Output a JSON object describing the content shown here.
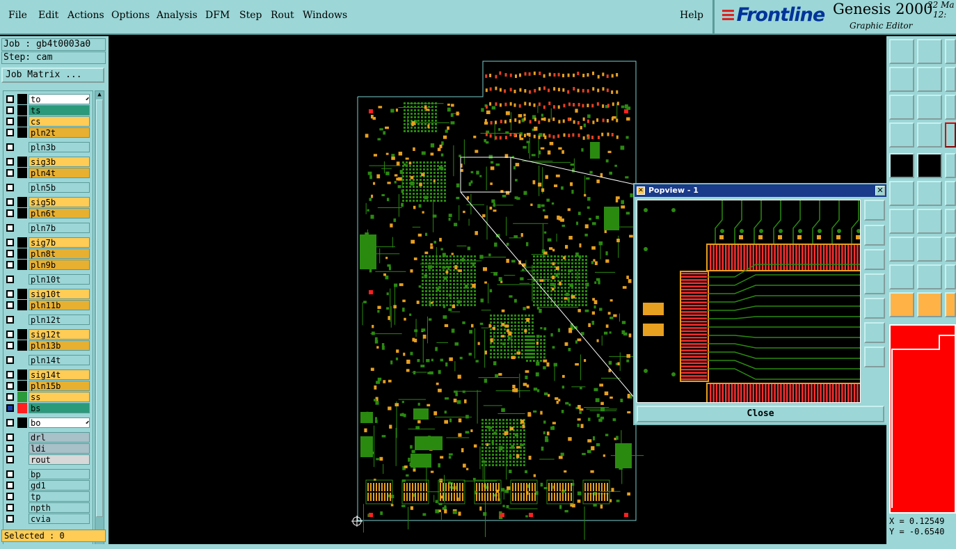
{
  "menu": {
    "file": "File",
    "edit": "Edit",
    "actions": "Actions",
    "options": "Options",
    "analysis": "Analysis",
    "dfm": "DFM",
    "step": "Step",
    "rout": "Rout",
    "windows": "Windows",
    "help": "Help"
  },
  "brand": {
    "logo": "Frontline",
    "title": "Genesis 2000",
    "subtitle": "Graphic Editor",
    "date_top": "22 Ma",
    "date_bottom": "12:"
  },
  "job": {
    "job_line": "Job : gb4t0003a0",
    "step_line": "Step: cam",
    "matrix_button": "Job Matrix ..."
  },
  "layers": [
    {
      "name": "to",
      "color": "#ffffff",
      "swatch": "#000000",
      "marker": "⬋"
    },
    {
      "name": "ts",
      "color": "#2a9a7a",
      "swatch": "#000000"
    },
    {
      "name": "cs",
      "color": "#ffcc55",
      "swatch": "#000000"
    },
    {
      "name": "pln2t",
      "color": "#e8b030",
      "swatch": "#000000"
    },
    {
      "name": "pln3b",
      "color": "#9cd6d6",
      "swatch": "#9cd6d6"
    },
    {
      "name": "sig3b",
      "color": "#ffcc55",
      "swatch": "#000000"
    },
    {
      "name": "pln4t",
      "color": "#e8b030",
      "swatch": "#000000"
    },
    {
      "name": "pln5b",
      "color": "#9cd6d6",
      "swatch": "#9cd6d6"
    },
    {
      "name": "sig5b",
      "color": "#ffcc55",
      "swatch": "#000000"
    },
    {
      "name": "pln6t",
      "color": "#e8b030",
      "swatch": "#000000"
    },
    {
      "name": "pln7b",
      "color": "#9cd6d6",
      "swatch": "#9cd6d6"
    },
    {
      "name": "sig7b",
      "color": "#ffcc55",
      "swatch": "#000000"
    },
    {
      "name": "pln8t",
      "color": "#e8b030",
      "swatch": "#000000"
    },
    {
      "name": "pln9b",
      "color": "#e8b030",
      "swatch": "#000000"
    },
    {
      "name": "pln10t",
      "color": "#9cd6d6",
      "swatch": "#9cd6d6"
    },
    {
      "name": "sig10t",
      "color": "#ffcc55",
      "swatch": "#000000"
    },
    {
      "name": "pln11b",
      "color": "#e8b030",
      "swatch": "#000000"
    },
    {
      "name": "pln12t",
      "color": "#9cd6d6",
      "swatch": "#9cd6d6"
    },
    {
      "name": "sig12t",
      "color": "#ffcc55",
      "swatch": "#000000"
    },
    {
      "name": "pln13b",
      "color": "#e8b030",
      "swatch": "#000000"
    },
    {
      "name": "pln14t",
      "color": "#9cd6d6",
      "swatch": "#9cd6d6"
    },
    {
      "name": "sig14t",
      "color": "#ffcc55",
      "swatch": "#000000"
    },
    {
      "name": "pln15b",
      "color": "#e8b030",
      "swatch": "#000000"
    },
    {
      "name": "ss",
      "color": "#ffcc55",
      "swatch": "#2a9a3a"
    },
    {
      "name": "bs",
      "color": "#2a9a7a",
      "swatch": "#ff2020",
      "checked": true
    },
    {
      "name": "bo",
      "color": "#ffffff",
      "swatch": "#000000",
      "marker": "⬋"
    },
    {
      "name": "drl",
      "color": "#a8c0c8",
      "swatch": "#9cd6d6"
    },
    {
      "name": "ldi",
      "color": "#a8c0c8",
      "swatch": "#9cd6d6"
    },
    {
      "name": "rout",
      "color": "#d8d8d8",
      "swatch": "#9cd6d6"
    },
    {
      "name": "bp",
      "color": "#9cd6d6",
      "swatch": "#9cd6d6"
    },
    {
      "name": "gd1",
      "color": "#9cd6d6",
      "swatch": "#9cd6d6"
    },
    {
      "name": "tp",
      "color": "#9cd6d6",
      "swatch": "#9cd6d6"
    },
    {
      "name": "npth",
      "color": "#9cd6d6",
      "swatch": "#9cd6d6"
    },
    {
      "name": "cvia",
      "color": "#9cd6d6",
      "swatch": "#9cd6d6"
    }
  ],
  "status": {
    "selected": "Selected : 0"
  },
  "coords": {
    "x": "X = 0.12549",
    "y": "Y = -0.6540"
  },
  "popview": {
    "title": "Popview - 1",
    "close_label": "Close"
  },
  "colors": {
    "panel": "#9cd6d6",
    "board_outline": "#7ad0d0",
    "copper": "#2a8a10",
    "pad": "#e8a020",
    "red_pad": "#ff2020"
  }
}
